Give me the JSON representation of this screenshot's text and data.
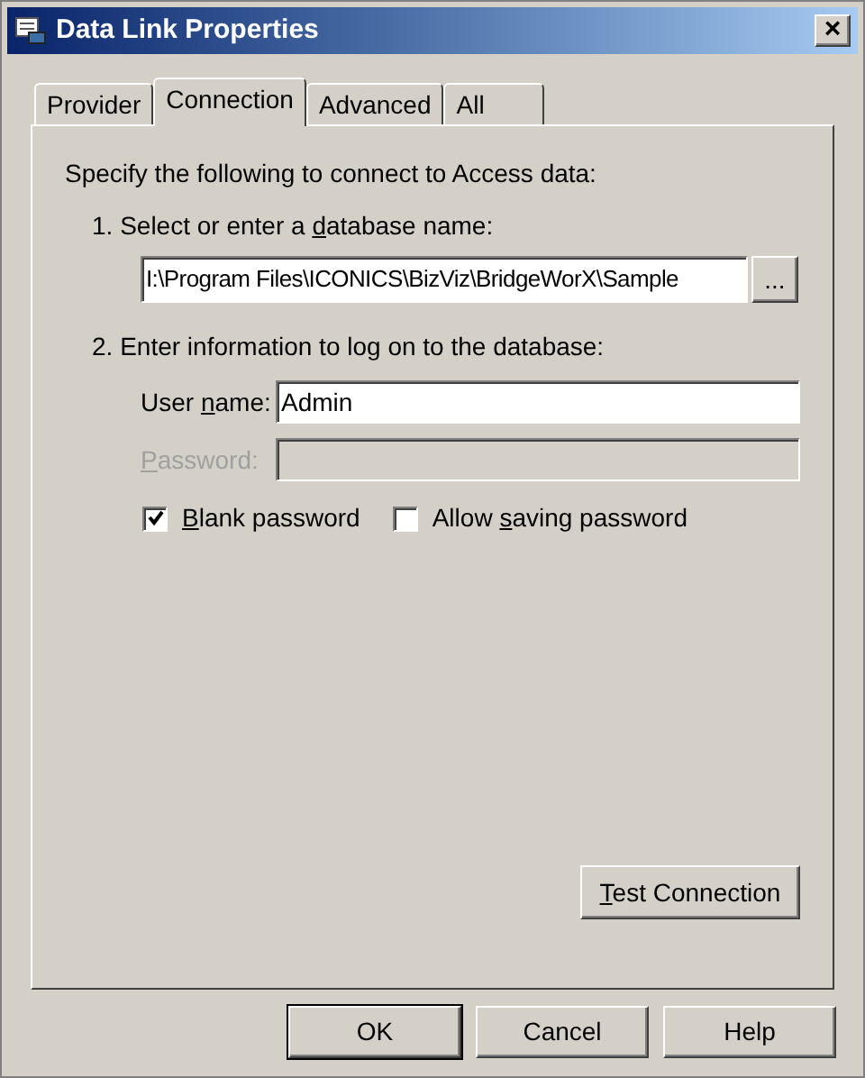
{
  "window": {
    "title": "Data Link Properties",
    "close": "×"
  },
  "tabs": [
    {
      "label": "Provider",
      "selected": false
    },
    {
      "label": "Connection",
      "selected": true
    },
    {
      "label": "Advanced",
      "selected": false
    },
    {
      "label": "All",
      "selected": false
    }
  ],
  "intro": "Specify the following to connect to Access data:",
  "step_1": {
    "label": [
      {
        "text": "1. Select or enter a ",
        "underlined": false
      },
      {
        "text": "d",
        "underlined": true
      },
      {
        "text": "atabase name:",
        "underlined": false
      }
    ],
    "value": "I:\\Program Files\\ICONICS\\BizViz\\BridgeWorX\\Sample",
    "browse": "..."
  },
  "step_2": {
    "label": "2. Enter information to log on to the database:",
    "fields": [
      {
        "label": [
          {
            "text": "User ",
            "underlined": false
          },
          {
            "text": "n",
            "underlined": true
          },
          {
            "text": "ame:",
            "underlined": false
          }
        ],
        "value": "Admin",
        "disabled": false
      },
      {
        "label": [
          {
            "text": "P",
            "underlined": true
          },
          {
            "text": "assword:",
            "underlined": false
          }
        ],
        "disabled": true
      }
    ],
    "checkboxes": [
      {
        "label": [
          {
            "text": "B",
            "underlined": true
          },
          {
            "text": "lank password",
            "underlined": false
          }
        ],
        "checked": true
      },
      {
        "label": [
          {
            "text": "Allow ",
            "underlined": false
          },
          {
            "text": "s",
            "underlined": true
          },
          {
            "text": "aving password",
            "underlined": false
          }
        ],
        "checked": false
      }
    ]
  },
  "test_button": {
    "label": [
      {
        "text": "T",
        "underlined": true
      },
      {
        "text": "est Connection",
        "underlined": false
      }
    ]
  },
  "buttons": [
    {
      "label": "OK",
      "default": true
    },
    {
      "label": "Cancel",
      "default": false
    },
    {
      "label": "Help",
      "default": false
    }
  ]
}
